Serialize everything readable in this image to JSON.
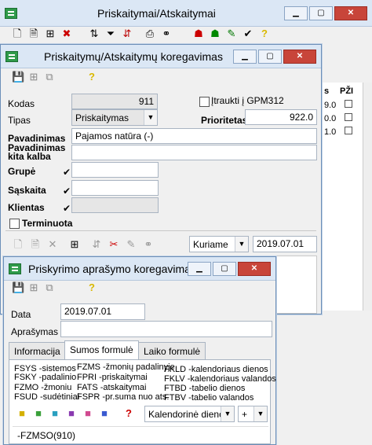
{
  "main_window": {
    "title": "Priskaitymai/Atskaitymai",
    "toolbar_icons": [
      "new-icon",
      "open-icon",
      "tree-icon",
      "delete-icon",
      "sort-icon",
      "filter-icon",
      "sort-az-icon",
      "print-icon",
      "binoculars-icon",
      "people-icon",
      "people-add-icon",
      "edit-icon",
      "check-icon",
      "help-icon"
    ],
    "grid_header": [
      "s",
      "PŽI"
    ],
    "grid_values": [
      "9.0",
      "0.0",
      "1.0"
    ]
  },
  "edit_window": {
    "title": "Priskaitymų/Atskaitymų koregavimas",
    "labels": {
      "kodas": "Kodas",
      "tipas": "Tipas",
      "pavadinimas": "Pavadinimas",
      "pavadinimas_kita": "Pavadinimas kita kalba",
      "grupe": "Grupė",
      "saskaita": "Sąskaita",
      "klientas": "Klientas",
      "terminuota": "Terminuota",
      "itraukti": "Įtraukti į GPM312",
      "prioritetas": "Prioritetas"
    },
    "values": {
      "kodas": "911",
      "tipas": "Priskaitymas",
      "pavadinimas": "Pajamos natūra (-)",
      "prioritetas": "922.0",
      "filter_mode": "Kuriame",
      "filter_date": "2019.07.01"
    }
  },
  "desc_window": {
    "title": "Priskyrimo aprašymo koregavimas",
    "labels": {
      "data": "Data",
      "aprasymas": "Aprašymas"
    },
    "values": {
      "data": "2019.07.01"
    },
    "tabs": [
      "Informacija",
      "Sumos formulė",
      "Laiko formulė"
    ],
    "active_tab": "Sumos formulė",
    "functions": [
      "FSYS -sistemos",
      "FZMS -žmonių padalinyje",
      "FKLD -kalendoriaus dienos",
      "FSKY -padalinio",
      "FPRI -priskaitymai",
      "FKLV -kalendoriaus valandos",
      "FZMO -žmoniu",
      "FATS -atskaitymai",
      "FTBD -tabelio dienos",
      "FSUD -sudėtiniai",
      "FSPR -pr.suma nuo ats.",
      "FTBV -tabelio valandos"
    ],
    "calendar_select": "Kalendorinė dieno",
    "operator_select": "+",
    "formula": "-FZMSO(910)"
  }
}
